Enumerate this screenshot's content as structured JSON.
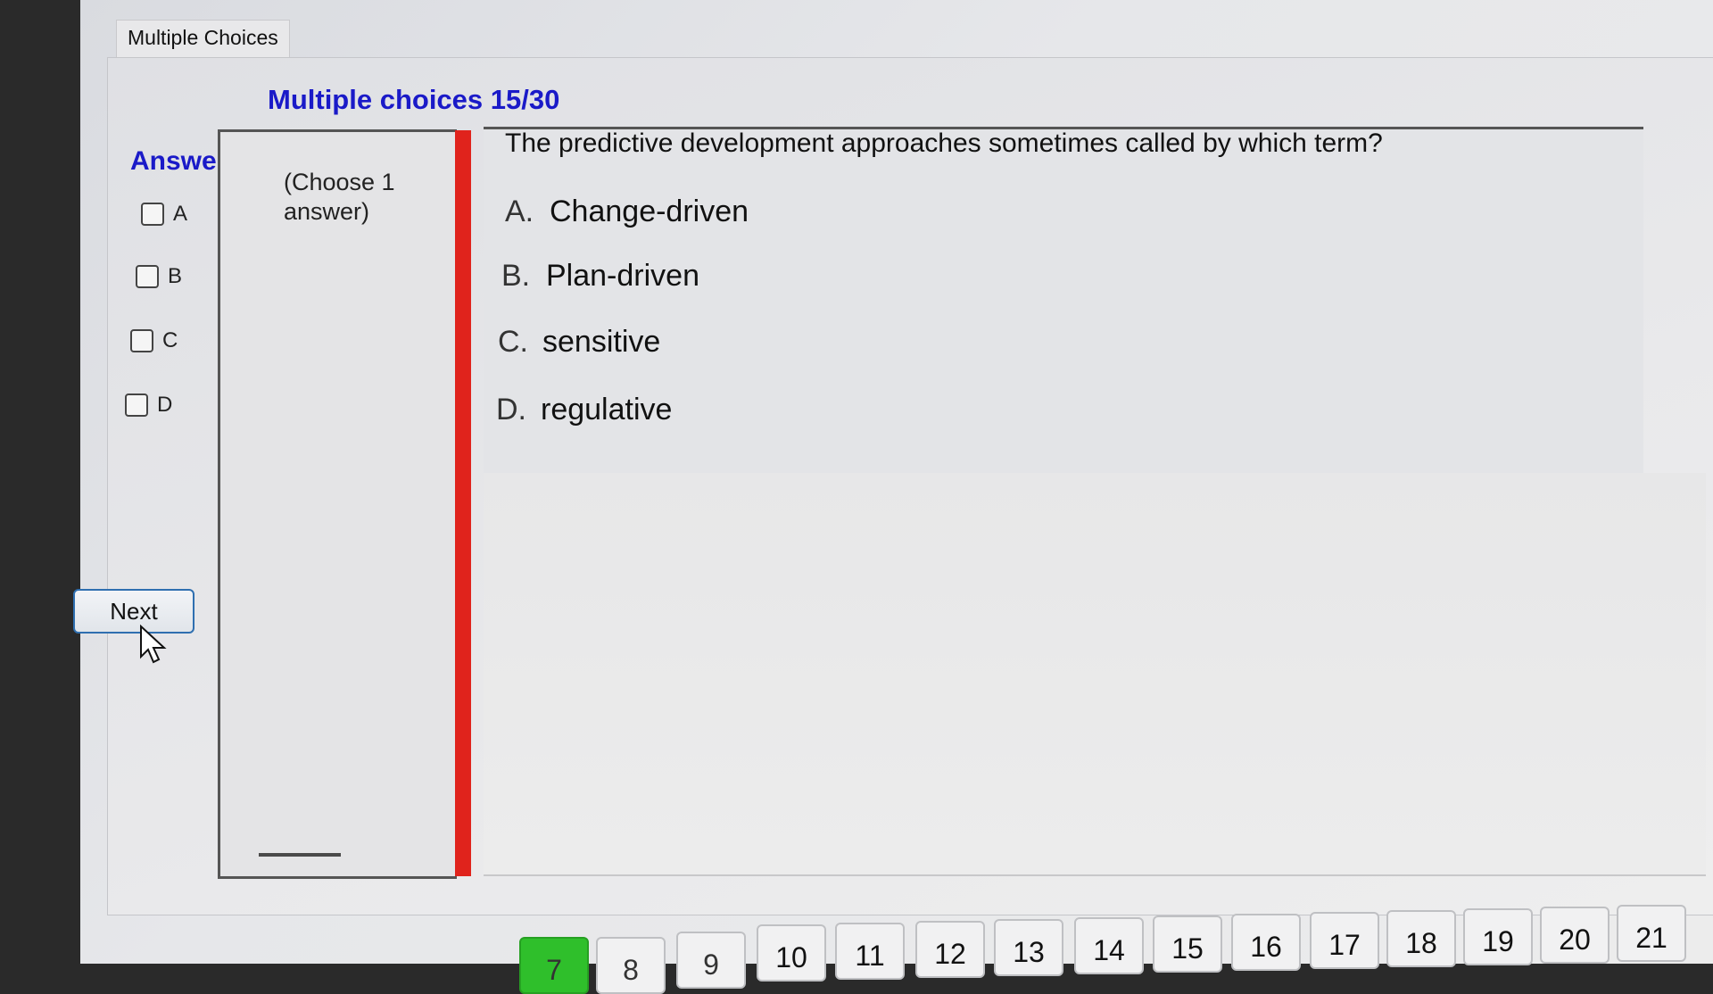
{
  "tab": {
    "label": "Multiple Choices"
  },
  "quiz": {
    "title": "Multiple choices 15/30"
  },
  "answer_panel": {
    "heading": "Answer",
    "options": [
      "A",
      "B",
      "C",
      "D"
    ],
    "next_label": "Next"
  },
  "choose_hint": "(Choose 1 answer)",
  "question": {
    "text": "The predictive development approaches sometimes called by which term?",
    "options": [
      {
        "letter": "A.",
        "text": "Change-driven"
      },
      {
        "letter": "B.",
        "text": "Plan-driven"
      },
      {
        "letter": "C.",
        "text": "sensitive"
      },
      {
        "letter": "D.",
        "text": "regulative"
      }
    ]
  },
  "pagination": {
    "pages": [
      "7",
      "8",
      "9",
      "10",
      "11",
      "12",
      "13",
      "14",
      "15",
      "16",
      "17",
      "18",
      "19",
      "20",
      "21"
    ],
    "current": "7",
    "current_color": "#2fbf2b"
  },
  "colors": {
    "title": "#1a1ac8",
    "divider": "#e0231c"
  }
}
